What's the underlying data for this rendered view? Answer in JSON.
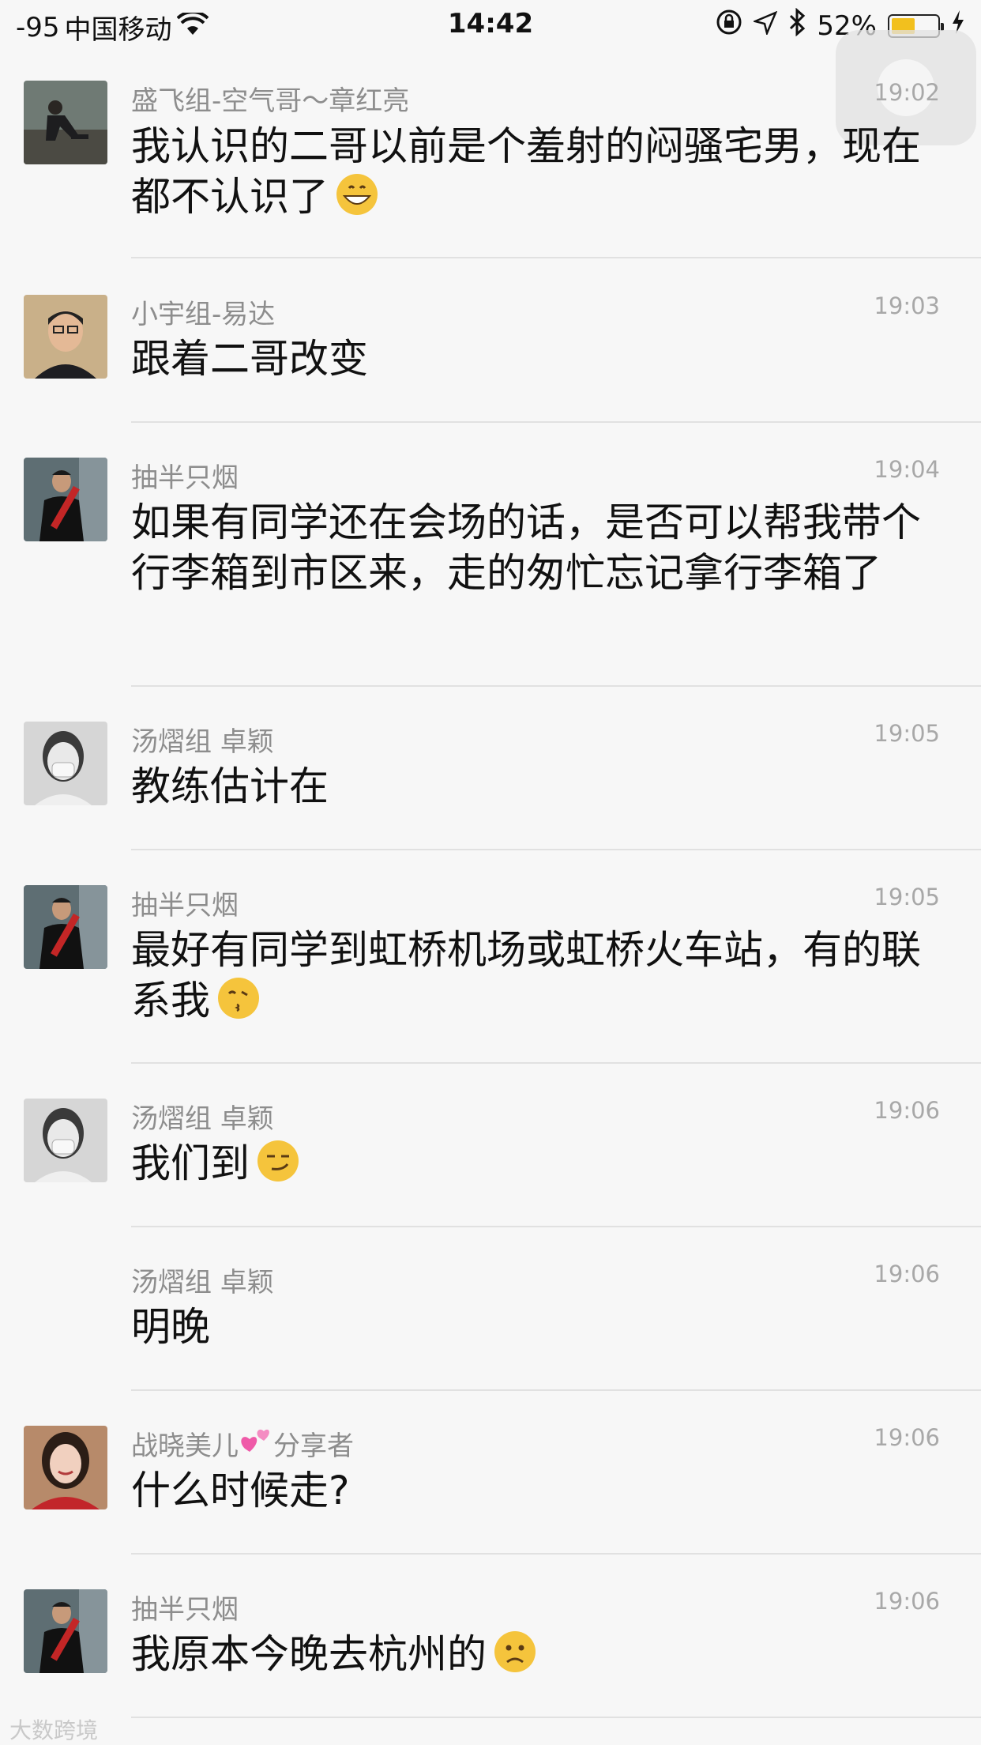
{
  "status": {
    "signal": "-95",
    "carrier": "中国移动",
    "time": "14:42",
    "battery": "52%",
    "battery_level": 0.52
  },
  "messages": [
    {
      "name": "盛飞组-空气哥～章红亮",
      "time": "19:02",
      "text": "我认识的二哥以前是个羞射的闷骚宅男，现在都不认识了",
      "emoji": "grinning-face"
    },
    {
      "name": "小宇组-易达",
      "time": "19:03",
      "text": "跟着二哥改变"
    },
    {
      "name": "抽半只烟",
      "time": "19:04",
      "text": "如果有同学还在会场的话，是否可以帮我带个行李箱到市区来，走的匆忙忘记拿行李箱了"
    },
    {
      "name": "汤熠组 卓颖",
      "time": "19:05",
      "text": "教练估计在"
    },
    {
      "name": "抽半只烟",
      "time": "19:05",
      "text": "最好有同学到虹桥机场或虹桥火车站，有的联系我",
      "emoji": "kissing-face"
    },
    {
      "name": "汤熠组 卓颖",
      "time": "19:06",
      "text": "我们到",
      "emoji": "smirking-face"
    },
    {
      "name": "汤熠组 卓颖",
      "time": "19:06",
      "text": "明晚"
    },
    {
      "name_prefix": "战晓美儿",
      "name_suffix": "分享者",
      "time": "19:06",
      "text": "什么时候走?",
      "name_emoji": "two-hearts"
    },
    {
      "name": "抽半只烟",
      "time": "19:06",
      "text": "我原本今晚去杭州的",
      "emoji": "frowning-face"
    }
  ],
  "watermark": "大数跨境"
}
